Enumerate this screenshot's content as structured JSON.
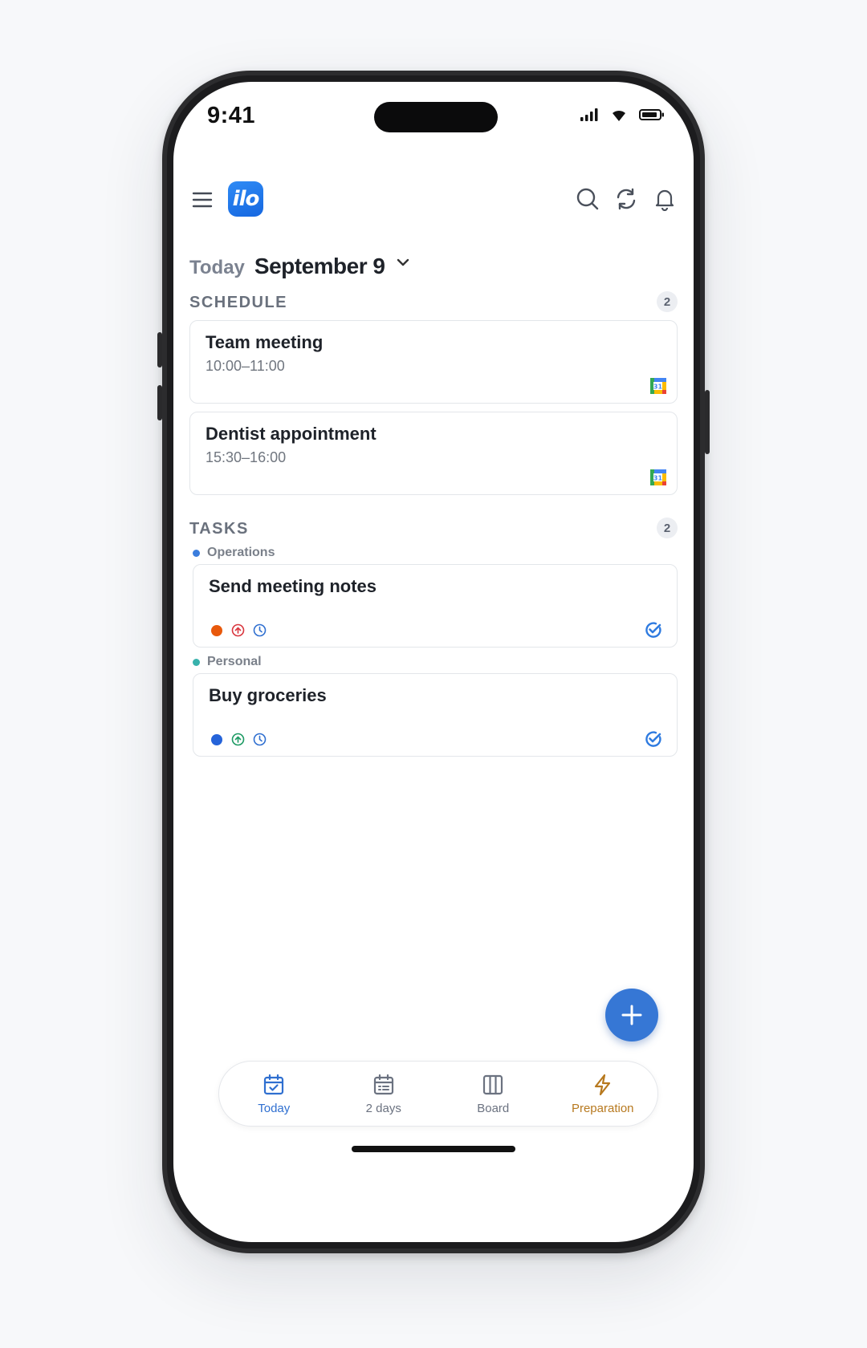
{
  "status_bar": {
    "time": "9:41"
  },
  "header": {
    "logo_text": "ilo",
    "actions": [
      "search-icon",
      "sync-icon",
      "bell-icon"
    ]
  },
  "date": {
    "prefix": "Today",
    "label": "September 9"
  },
  "schedule": {
    "title": "SCHEDULE",
    "count": "2",
    "events": [
      {
        "title": "Team meeting",
        "time": "10:00–11:00",
        "source_icon": "google-calendar-icon"
      },
      {
        "title": "Dentist appointment",
        "time": "15:30–16:00",
        "source_icon": "google-calendar-icon"
      }
    ]
  },
  "tasks": {
    "title": "TASKS",
    "count": "2",
    "groups": [
      {
        "name": "Operations",
        "color": "#3b7ddd",
        "task": {
          "title": "Send meeting notes",
          "status_color": "#e8590c",
          "priority_color": "#d9363e"
        }
      },
      {
        "name": "Personal",
        "color": "#38b2ac",
        "task": {
          "title": "Buy groceries",
          "status_color": "#2563d9",
          "priority_color": "#1c9a63"
        }
      }
    ]
  },
  "bottom_nav": {
    "items": [
      {
        "label": "Today",
        "color": "#2f6fd0"
      },
      {
        "label": "2 days",
        "color": "#6b7280"
      },
      {
        "label": "Board",
        "color": "#6b7280"
      },
      {
        "label": "Preparation",
        "color": "#b7791f"
      }
    ]
  },
  "colors": {
    "accent": "#3677d5",
    "brand": "#1f7aec"
  }
}
